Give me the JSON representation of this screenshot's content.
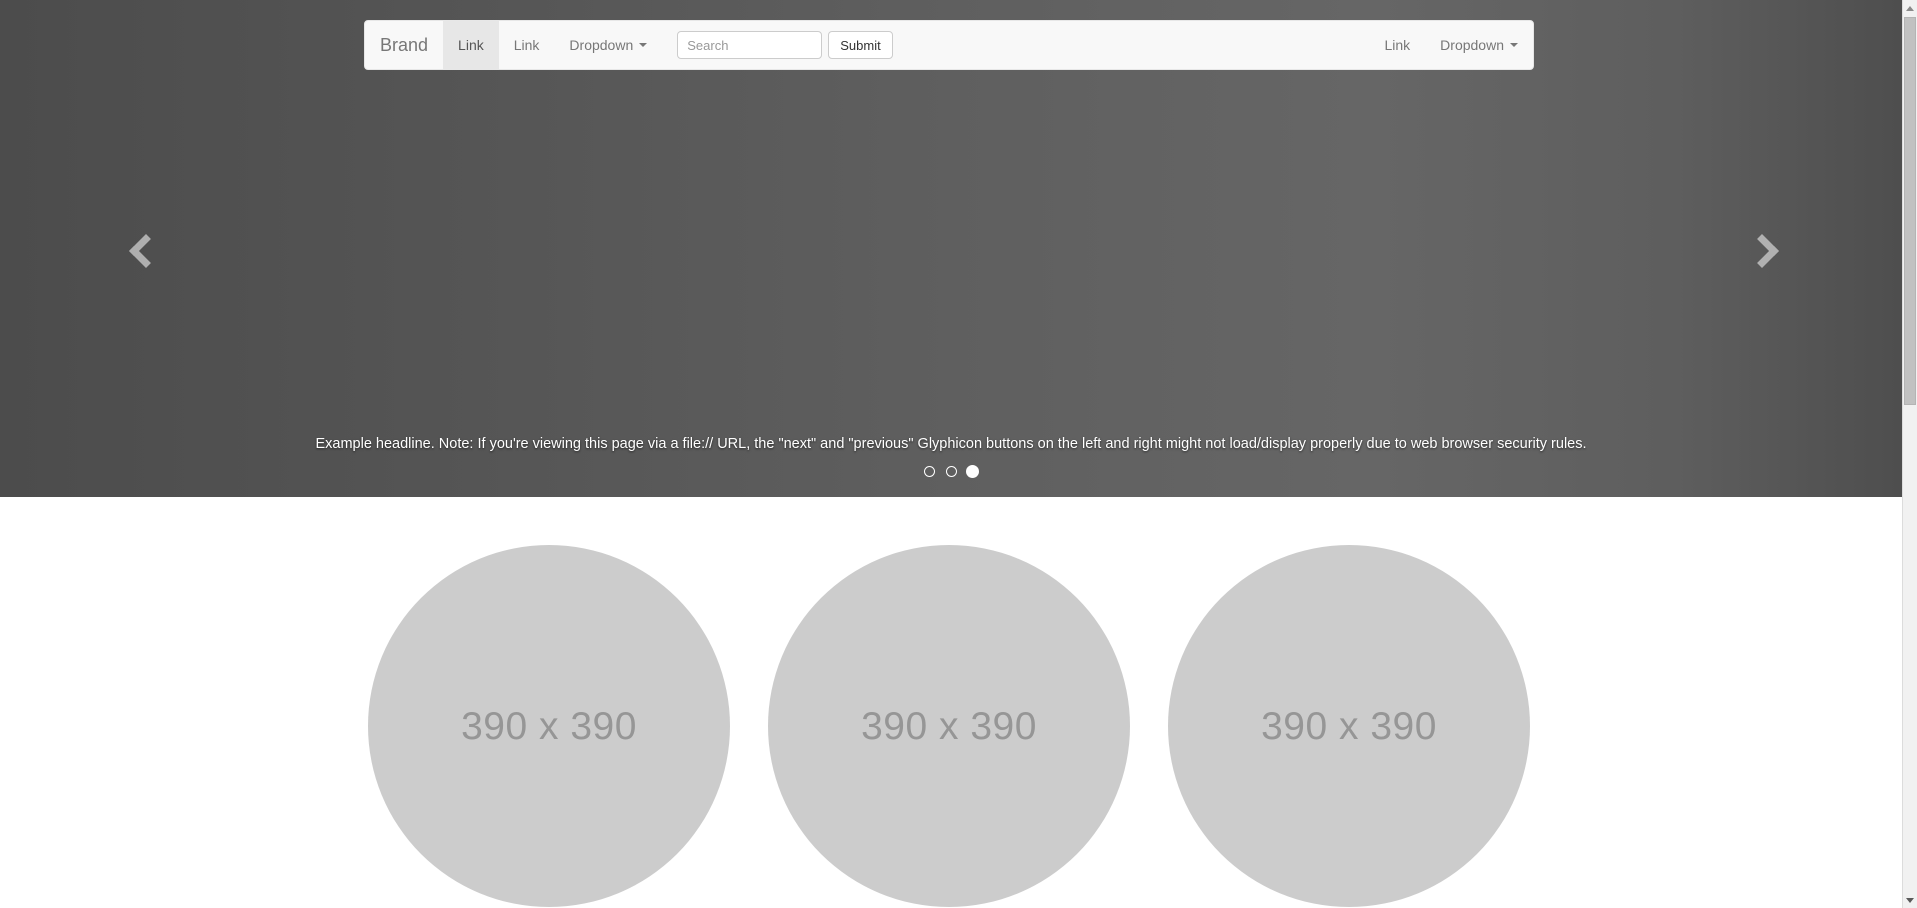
{
  "navbar": {
    "brand": "Brand",
    "left_items": [
      {
        "label": "Link",
        "active": true,
        "has_caret": false
      },
      {
        "label": "Link",
        "active": false,
        "has_caret": false
      },
      {
        "label": "Dropdown",
        "active": false,
        "has_caret": true
      }
    ],
    "right_items": [
      {
        "label": "Link",
        "active": false,
        "has_caret": false
      },
      {
        "label": "Dropdown",
        "active": false,
        "has_caret": true
      }
    ],
    "search": {
      "placeholder": "Search",
      "value": "",
      "submit_label": "Submit"
    },
    "background_color": "#f8f8f8",
    "text_color": "#777777",
    "active_background": "#e7e7e7"
  },
  "carousel": {
    "prev_label": "Previous",
    "next_label": "Next",
    "prev_icon": "chevron-left-icon",
    "next_icon": "chevron-right-icon",
    "caption": "Example headline. Note: If you're viewing this page via a file:// URL, the \"next\" and \"previous\" Glyphicon buttons on the left and right might not load/display properly due to web browser security rules.",
    "indicators": [
      {
        "active": false
      },
      {
        "active": false
      },
      {
        "active": true
      }
    ],
    "active_slide": 3,
    "slide_count": 3,
    "background_color": "#5a5a5a",
    "caption_color": "#ffffff"
  },
  "marketing": {
    "columns": [
      {
        "thumb_label": "390 x 390"
      },
      {
        "thumb_label": "390 x 390"
      },
      {
        "thumb_label": "390 x 390"
      }
    ],
    "thumb_color": "#cccccc",
    "thumb_text_color": "#969696"
  },
  "scrollbar": {
    "up_icon": "scroll-up-arrow-icon",
    "down_icon": "scroll-down-arrow-icon",
    "track_color": "#f1f1f1",
    "thumb_color": "#c1c1c1"
  }
}
